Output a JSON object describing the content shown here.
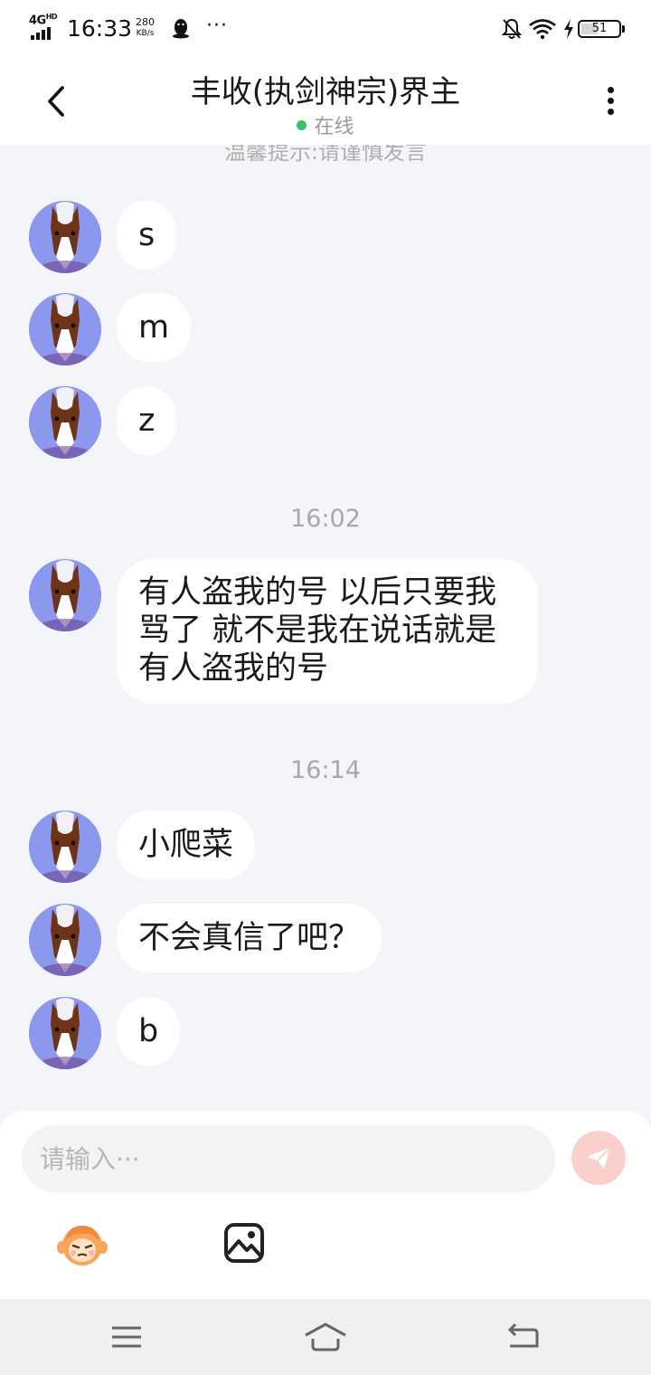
{
  "status_bar": {
    "network": "4G",
    "network_sup": "HD",
    "time": "16:33",
    "speed_value": "280",
    "speed_unit": "KB/s",
    "more": "···",
    "battery": "51",
    "battery_level": 0.51
  },
  "header": {
    "title": "丰收(执剑神宗)界主",
    "status": "在线",
    "status_color": "#36c46b"
  },
  "chat": {
    "tip": "温馨提示:请谨慎发言",
    "messages": [
      {
        "text": "s"
      },
      {
        "text": "m"
      },
      {
        "text": "z"
      },
      {
        "time": "16:02"
      },
      {
        "text": "有人盗我的号 以后只要我骂了 就不是我在说话就是有人盗我的号"
      },
      {
        "time": "16:14"
      },
      {
        "text": "小爬菜"
      },
      {
        "text": "不会真信了吧？"
      },
      {
        "text": "b"
      }
    ]
  },
  "composer": {
    "placeholder": "请输入···",
    "send_icon": "send-icon",
    "emoji_icon": "emoji-icon",
    "image_icon": "image-icon"
  },
  "colors": {
    "background": "#f4f5f8",
    "bubble": "#ffffff",
    "send_button": "#fbd0cc",
    "avatar_bg": "#8c98ee"
  }
}
